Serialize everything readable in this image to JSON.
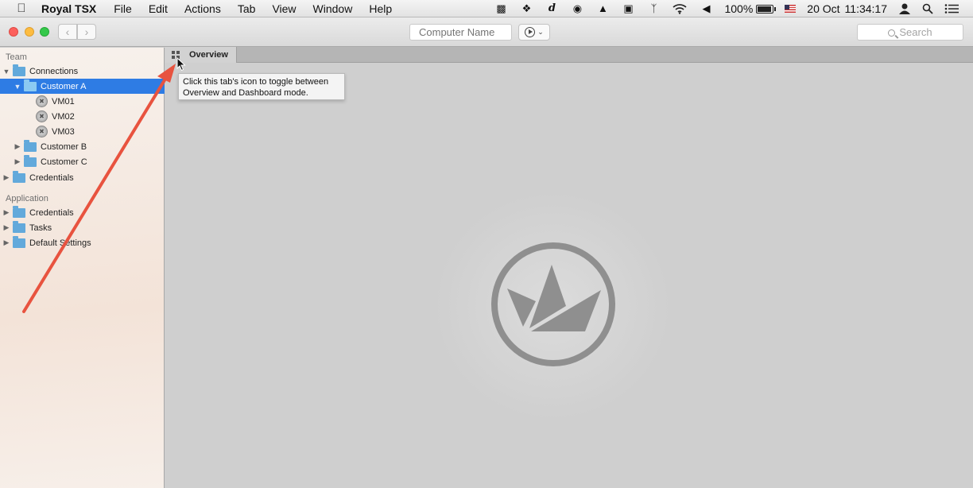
{
  "menubar": {
    "app_name": "Royal TSX",
    "items": [
      "File",
      "Edit",
      "Actions",
      "Tab",
      "View",
      "Window",
      "Help"
    ],
    "status": {
      "battery_percent": "100%",
      "battery_level": 1.0,
      "date": "20 Oct",
      "time": "11:34:17"
    }
  },
  "toolbar": {
    "computer_name_placeholder": "Computer Name",
    "search_placeholder": "Search"
  },
  "sidebar": {
    "team_header": "Team",
    "team_items": {
      "connections": "Connections",
      "customer_a": "Customer A",
      "vm01": "VM01",
      "vm02": "VM02",
      "vm03": "VM03",
      "customer_b": "Customer B",
      "customer_c": "Customer C",
      "credentials": "Credentials"
    },
    "application_header": "Application",
    "application_items": {
      "credentials": "Credentials",
      "tasks": "Tasks",
      "default_settings": "Default Settings"
    }
  },
  "tabs": {
    "overview_label": "Overview"
  },
  "tooltip": {
    "line1": "Click this tab's icon to toggle between",
    "line2": "Overview and Dashboard mode."
  },
  "colors": {
    "selection": "#2e7ce4",
    "folder": "#62a9db",
    "annotation_arrow": "#e8533f"
  }
}
